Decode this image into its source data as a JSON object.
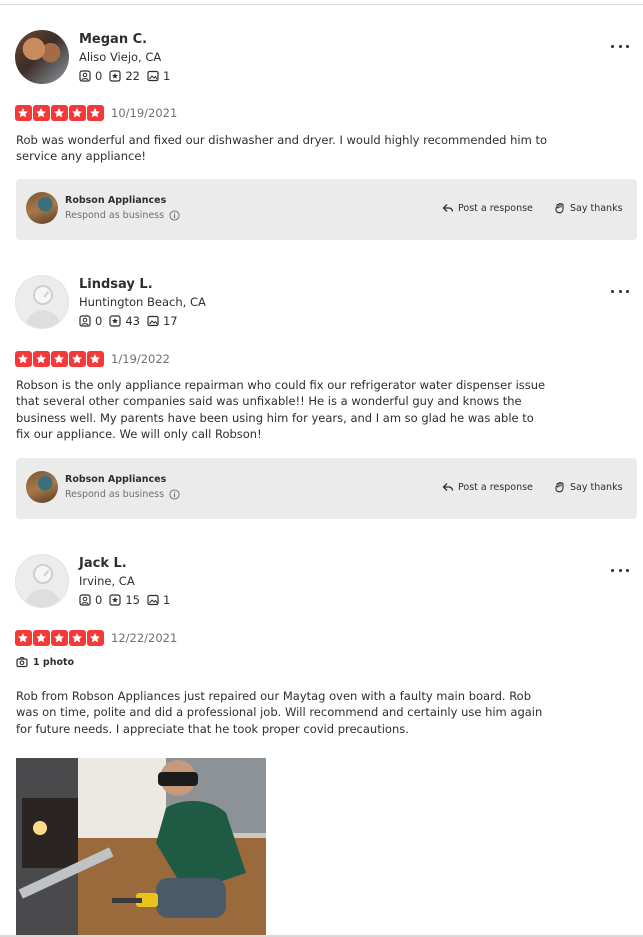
{
  "reviews": [
    {
      "name": "Megan C.",
      "location": "Aliso Viejo, CA",
      "friends": "0",
      "reviews": "22",
      "photos": "1",
      "date": "10/19/2021",
      "rating": 5,
      "text": "Rob was wonderful and fixed our dishwasher and dryer. I would highly recommended him to service any appliance!"
    },
    {
      "name": "Lindsay L.",
      "location": "Huntington Beach, CA",
      "friends": "0",
      "reviews": "43",
      "photos": "17",
      "date": "1/19/2022",
      "rating": 5,
      "text": "Robson is the only appliance repairman who could fix our refrigerator water dispenser issue that several other companies said was unfixable!! He is a wonderful guy and knows the business well. My parents have been using him for years, and I am so glad he was able to fix our appliance. We will only call Robson!"
    },
    {
      "name": "Jack L.",
      "location": "Irvine, CA",
      "friends": "0",
      "reviews": "15",
      "photos": "1",
      "date": "12/22/2021",
      "rating": 5,
      "photo_count_label": "1 photo",
      "text": "Rob from Robson Appliances just repaired our Maytag oven with a faulty main board. Rob was on time, polite and did a professional job. Will recommend and certainly use him again for future needs. I appreciate that he took proper covid precautions."
    }
  ],
  "business": {
    "name": "Robson Appliances",
    "respond_label": "Respond as business",
    "post_response_label": "Post a response",
    "say_thanks_label": "Say thanks"
  },
  "colors": {
    "star_red": "#f43939",
    "panel_gray": "#ebebeb",
    "text_dark": "#2d2e2f",
    "text_muted": "#6e7072"
  },
  "icons": [
    "friends-icon",
    "reviews-icon",
    "photos-icon",
    "more-options-icon",
    "star-icon",
    "info-icon",
    "reply-icon",
    "thanks-icon",
    "camera-icon"
  ]
}
